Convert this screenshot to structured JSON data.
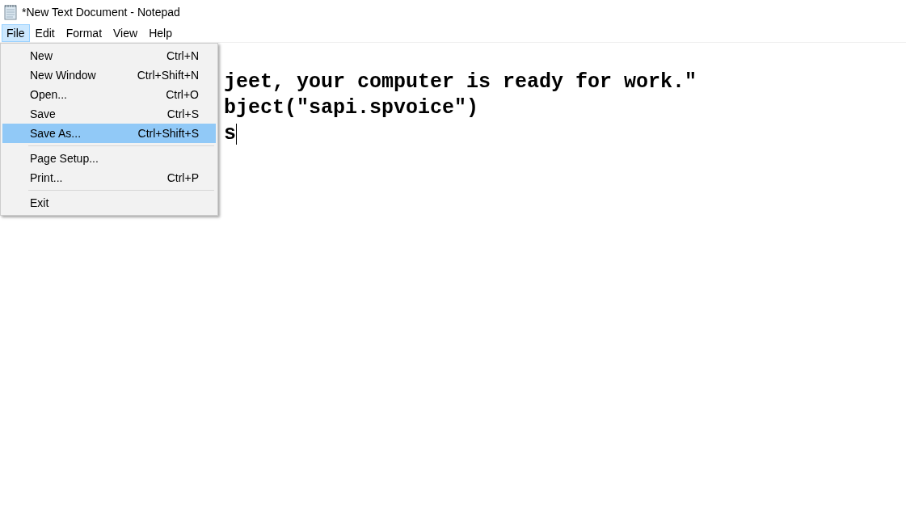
{
  "window": {
    "title": "*New Text Document - Notepad"
  },
  "menu_bar": [
    {
      "label": "File",
      "selected": true
    },
    {
      "label": "Edit",
      "selected": false
    },
    {
      "label": "Format",
      "selected": false
    },
    {
      "label": "View",
      "selected": false
    },
    {
      "label": "Help",
      "selected": false
    }
  ],
  "file_menu": [
    {
      "kind": "item",
      "label": "New",
      "shortcut": "Ctrl+N",
      "selected": false
    },
    {
      "kind": "item",
      "label": "New Window",
      "shortcut": "Ctrl+Shift+N",
      "selected": false
    },
    {
      "kind": "item",
      "label": "Open...",
      "shortcut": "Ctrl+O",
      "selected": false
    },
    {
      "kind": "item",
      "label": "Save",
      "shortcut": "Ctrl+S",
      "selected": false
    },
    {
      "kind": "item",
      "label": "Save As...",
      "shortcut": "Ctrl+Shift+S",
      "selected": true
    },
    {
      "kind": "separator"
    },
    {
      "kind": "item",
      "label": "Page Setup...",
      "selected": false
    },
    {
      "kind": "item",
      "label": "Print...",
      "shortcut": "Ctrl+P",
      "selected": false
    },
    {
      "kind": "separator"
    },
    {
      "kind": "item",
      "label": "Exit",
      "selected": false
    }
  ],
  "editor": {
    "lines": [
      "jeet, your computer is ready for work.\"",
      "bject(\"sapi.spvoice\")",
      "s"
    ]
  }
}
